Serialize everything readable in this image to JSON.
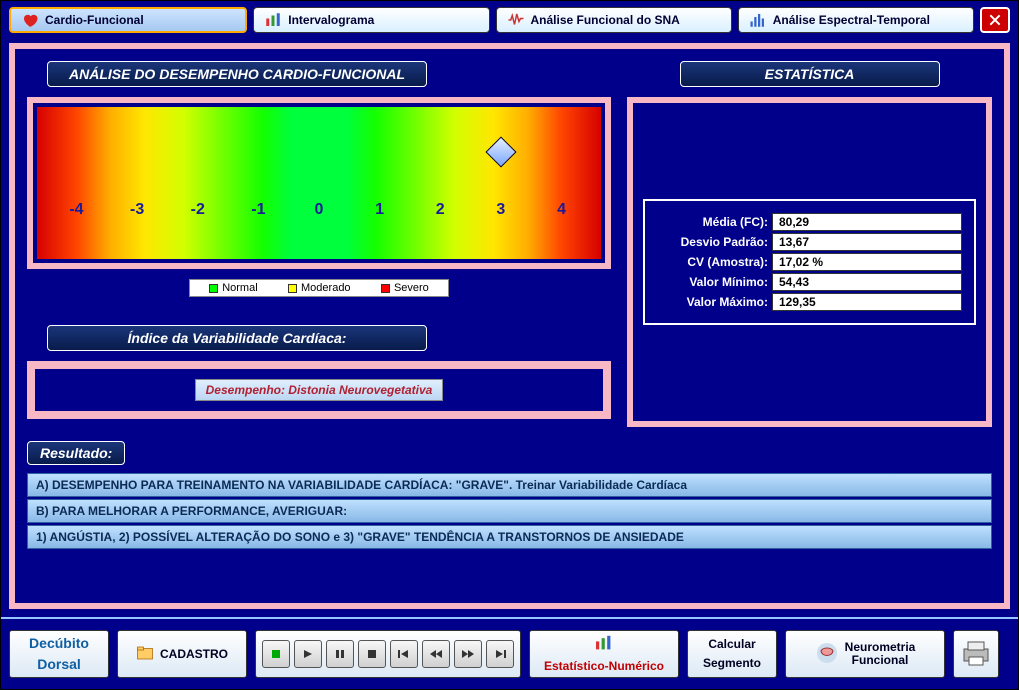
{
  "tabs": {
    "t0": "Cardio-Funcional",
    "t1": "Intervalograma",
    "t2": "Análise Funcional do SNA",
    "t3": "Análise Espectral-Temporal"
  },
  "headers": {
    "left": "ANÁLISE DO DESEMPENHO CARDIO-FUNCIONAL",
    "right": "ESTATÍSTICA",
    "ivc": "Índice da Variabilidade Cardíaca:",
    "resultado": "Resultado:"
  },
  "spectrum": {
    "ticks": [
      "-4",
      "-3",
      "-2",
      "-1",
      "0",
      "1",
      "2",
      "3",
      "4"
    ],
    "marker_value": 3
  },
  "legend": {
    "normal": "Normal",
    "moderado": "Moderado",
    "severo": "Severo"
  },
  "performance": "Desempenho: Distonia Neurovegetativa",
  "stats": {
    "media_label": "Média (FC):",
    "media_val": "80,29",
    "desvio_label": "Desvio Padrão:",
    "desvio_val": "13,67",
    "cv_label": "CV (Amostra):",
    "cv_val": "17,02 %",
    "min_label": "Valor Mínimo:",
    "min_val": "54,43",
    "max_label": "Valor Máximo:",
    "max_val": "129,35"
  },
  "results": {
    "r0": "A) DESEMPENHO PARA TREINAMENTO NA VARIABILIDADE CARDÍACA: \"GRAVE\". Treinar Variabilidade Cardíaca",
    "r1": "B) PARA MELHORAR A PERFORMANCE, AVERIGUAR:",
    "r2": "1) ANGÚSTIA, 2) POSSÍVEL ALTERAÇÃO DO SONO e 3) \"GRAVE\" TENDÊNCIA A TRANSTORNOS DE ANSIEDADE"
  },
  "footer": {
    "decubito1": "Decúbito",
    "decubito2": "Dorsal",
    "cadastro": "CADASTRO",
    "estat": "Estatístico-Numérico",
    "calc1": "Calcular",
    "calc2": "Segmento",
    "neuro1": "Neurometria",
    "neuro2": "Funcional"
  }
}
